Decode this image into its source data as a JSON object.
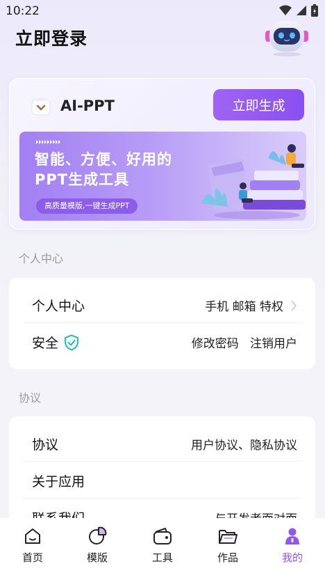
{
  "status_bar": {
    "time": "10:22"
  },
  "header": {
    "title": "立即登录"
  },
  "banner": {
    "app_name": "AI-PPT",
    "generate_button": "立即生成",
    "promo_headline_line1": "智能、方便、好用的",
    "promo_headline_line2": "PPT生成工具",
    "promo_tagline": "高质量模版,一键生成PPT"
  },
  "section_personal": {
    "label": "个人中心",
    "rows": [
      {
        "title": "个人中心",
        "right_text": "手机 邮箱 特权"
      },
      {
        "title": "安全",
        "right_text": "修改密码   注销用户"
      }
    ]
  },
  "section_agreement": {
    "label": "协议",
    "rows": [
      {
        "title": "协议",
        "right_text": "用户协议、隐私协议"
      },
      {
        "title": "关于应用",
        "right_text": ""
      },
      {
        "title": "联系我们",
        "right_text": "与开发者面对面"
      }
    ]
  },
  "tabs": [
    {
      "label": "首页",
      "icon": "home-icon"
    },
    {
      "label": "模版",
      "icon": "template-icon"
    },
    {
      "label": "工具",
      "icon": "wallet-icon"
    },
    {
      "label": "作品",
      "icon": "folder-icon"
    },
    {
      "label": "我的",
      "icon": "user-icon",
      "active": true
    }
  ],
  "colors": {
    "accent": "#9557ea",
    "button": "#8a4ff0",
    "secure_icon": "#1fb5a2"
  }
}
